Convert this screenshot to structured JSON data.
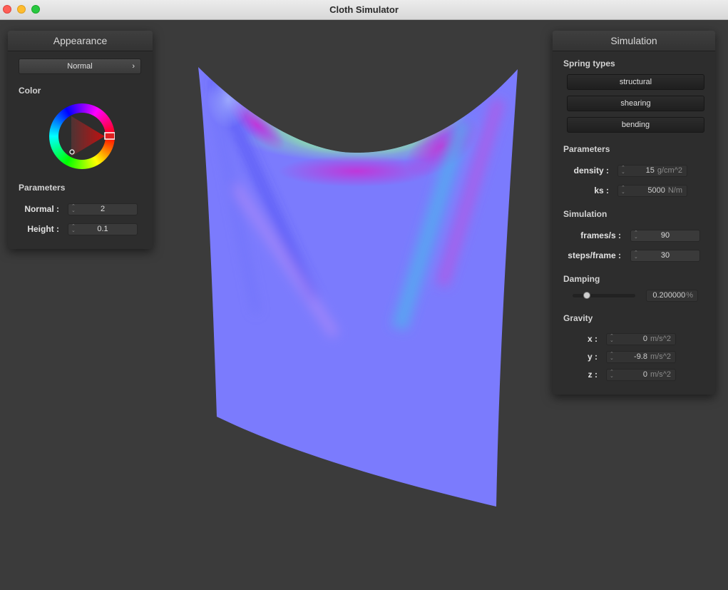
{
  "window": {
    "title": "Cloth Simulator"
  },
  "appearance": {
    "title": "Appearance",
    "shader_label": "Normal",
    "color_label": "Color",
    "params_label": "Parameters",
    "normal": {
      "label": "Normal :",
      "value": "2"
    },
    "height": {
      "label": "Height :",
      "value": "0.1"
    }
  },
  "simulation_panel": {
    "title": "Simulation",
    "spring_types_label": "Spring types",
    "spring_buttons": [
      "structural",
      "shearing",
      "bending"
    ],
    "params_label": "Parameters",
    "density": {
      "label": "density :",
      "value": "15",
      "unit": "g/cm^2"
    },
    "ks": {
      "label": "ks :",
      "value": "5000",
      "unit": "N/m"
    },
    "sim_label": "Simulation",
    "frames": {
      "label": "frames/s :",
      "value": "90"
    },
    "steps": {
      "label": "steps/frame :",
      "value": "30"
    },
    "damping_label": "Damping",
    "damping": {
      "value": "0.200000",
      "unit": "%",
      "fraction": 0.2
    },
    "gravity_label": "Gravity",
    "gravity": {
      "x": {
        "label": "x :",
        "value": "0",
        "unit": "m/s^2"
      },
      "y": {
        "label": "y :",
        "value": "-9.8",
        "unit": "m/s^2"
      },
      "z": {
        "label": "z :",
        "value": "0",
        "unit": "m/s^2"
      }
    }
  },
  "colors": {
    "cloth_base": "#7b7bfd",
    "cloth_green": "#8ef0a0",
    "cloth_magenta": "#c234d8",
    "cloth_cyan": "#5aa6f0",
    "background": "#3b3b3b"
  }
}
